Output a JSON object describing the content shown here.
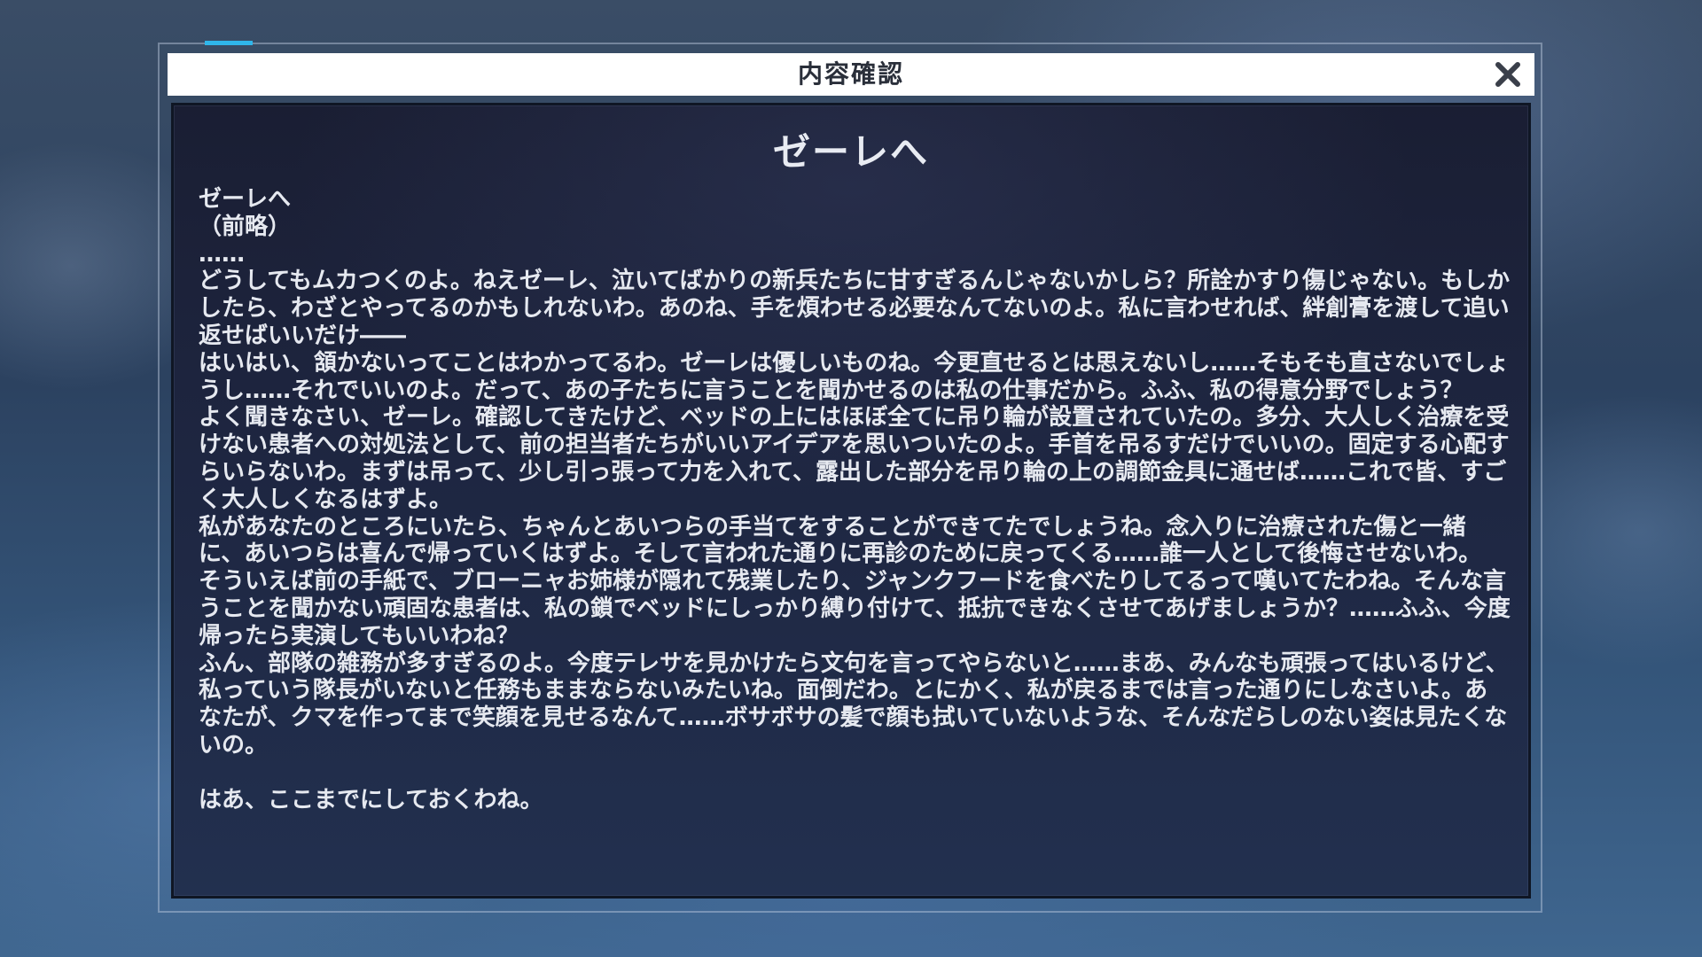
{
  "dialog": {
    "title": "内容確認",
    "close_label": "×"
  },
  "letter": {
    "heading": "ゼーレへ",
    "greeting": "ゼーレへ",
    "preface": "（前略）",
    "ellipsis": "……",
    "paragraphs": [
      "どうしてもムカつくのよ。ねえゼーレ、泣いてばかりの新兵たちに甘すぎるんじゃないかしら？所詮かすり傷じゃない。もしかしたら、わざとやってるのかもしれないわ。あのね、手を煩わせる必要なんてないのよ。私に言わせれば、絆創膏を渡して追い返せばいいだけ――",
      "はいはい、頷かないってことはわかってるわ。ゼーレは優しいものね。今更直せるとは思えないし……そもそも直さないでしょうし……それでいいのよ。だって、あの子たちに言うことを聞かせるのは私の仕事だから。ふふ、私の得意分野でしょう？",
      "よく聞きなさい、ゼーレ。確認してきたけど、ベッドの上にはほぼ全てに吊り輪が設置されていたの。多分、大人しく治療を受けない患者への対処法として、前の担当者たちがいいアイデアを思いついたのよ。手首を吊るすだけでいいの。固定する心配すらいらないわ。まずは吊って、少し引っ張って力を入れて、露出した部分を吊り輪の上の調節金具に通せば……これで皆、すごく大人しくなるはずよ。",
      "私があなたのところにいたら、ちゃんとあいつらの手当てをすることができてたでしょうね。念入りに治療された傷と一緒に、あいつらは喜んで帰っていくはずよ。そして言われた通りに再診のために戻ってくる……誰一人として後悔させないわ。",
      "そういえば前の手紙で、ブローニャお姉様が隠れて残業したり、ジャンクフードを食べたりしてるって嘆いてたわね。そんな言うことを聞かない頑固な患者は、私の鎖でベッドにしっかり縛り付けて、抵抗できなくさせてあげましょうか？……ふふ、今度帰ったら実演してもいいわね？",
      "ふん、部隊の雑務が多すぎるのよ。今度テレサを見かけたら文句を言ってやらないと……まあ、みんなも頑張ってはいるけど、私っていう隊長がいないと任務もままならないみたいね。面倒だわ。とにかく、私が戻るまでは言った通りにしなさいよ。あなたが、クマを作ってまで笑顔を見せるなんて……ボサボサの髪で顔も拭いていないような、そんなだらしのない姿は見たくないの。"
    ],
    "closing": "はあ、ここまでにしておくわね。"
  },
  "colors": {
    "accent": "#2fb6ea",
    "panel": "#1e2641",
    "text": "#e6e9f0"
  },
  "icons": {
    "close": "close-icon"
  }
}
